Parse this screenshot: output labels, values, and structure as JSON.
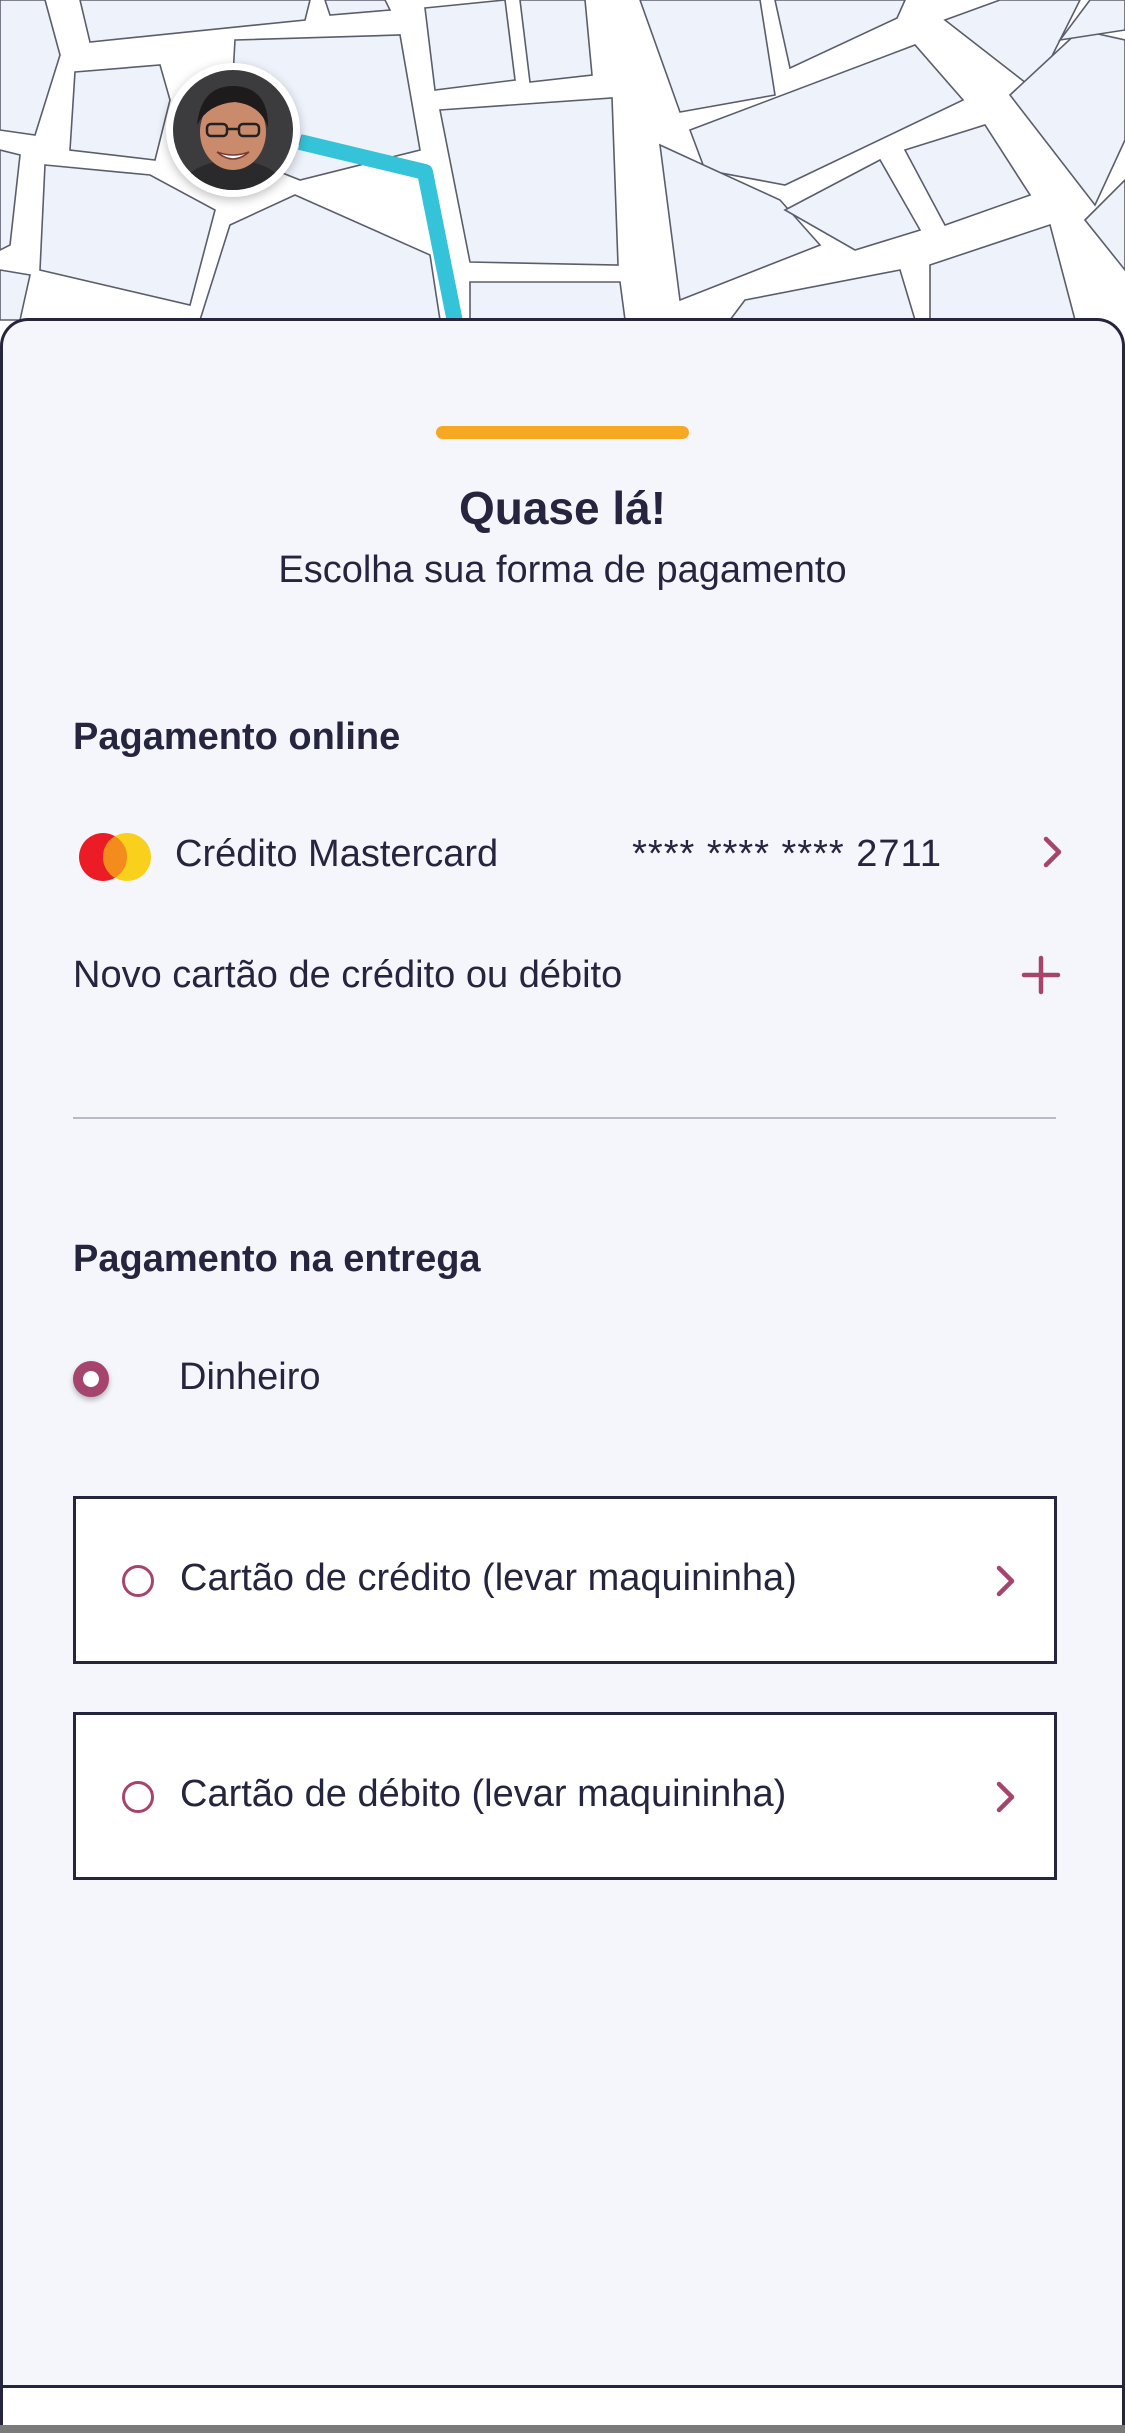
{
  "header": {
    "title": "Quase lá!",
    "subtitle": "Escolha sua forma de pagamento"
  },
  "online_payment": {
    "section_title": "Pagamento online",
    "saved_card": {
      "label": "Crédito Mastercard",
      "masked_number": "**** **** **** 2711",
      "brand_icon": "mastercard-logo"
    },
    "new_card_label": "Novo cartão de crédito ou débito",
    "add_icon": "plus-icon"
  },
  "delivery_payment": {
    "section_title": "Pagamento na entrega",
    "options": [
      {
        "label": "Dinheiro",
        "selected": true
      },
      {
        "label": "Cartão de crédito (levar maquininha)",
        "selected": false
      },
      {
        "label": "Cartão de débito (levar maquininha)",
        "selected": false
      }
    ]
  },
  "colors": {
    "accent": "#a5456d",
    "handle": "#f7a823",
    "route": "#34c3d8",
    "text": "#25253f",
    "sheet_bg": "#f5f6fc",
    "map_block": "#eef3fb"
  }
}
